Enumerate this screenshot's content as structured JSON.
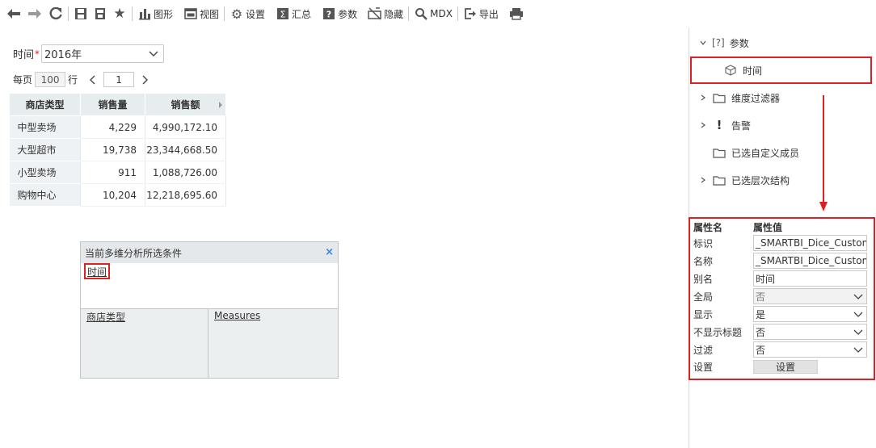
{
  "toolbar": {
    "chart_label": "图形",
    "view_label": "视图",
    "settings_label": "设置",
    "summary_label": "汇总",
    "params_label": "参数",
    "hide_label": "隐藏",
    "mdx_label": "MDX",
    "export_label": "导出"
  },
  "filter": {
    "label": "时间",
    "required_mark": "*",
    "value": "2016年"
  },
  "pager": {
    "per_page_label": "每页",
    "per_page_value": "100",
    "row_label": "行",
    "current_page": "1"
  },
  "table": {
    "headers": [
      "商店类型",
      "销售量",
      "销售额"
    ],
    "rows": [
      {
        "type": "中型卖场",
        "qty": "4,229",
        "amount": "4,990,172.10"
      },
      {
        "type": "大型超市",
        "qty": "19,738",
        "amount": "23,344,668.50"
      },
      {
        "type": "小型卖场",
        "qty": "911",
        "amount": "1,088,726.00"
      },
      {
        "type": "购物中心",
        "qty": "10,204",
        "amount": "12,218,695.60"
      }
    ]
  },
  "conditions": {
    "title": "当前多维分析所选条件",
    "close": "×",
    "selected_chip": "时间",
    "col1": "商店类型",
    "col2": "Measures"
  },
  "tree": {
    "params": {
      "bracket": "[?]",
      "label": "参数"
    },
    "param_time": "时间",
    "dim_filter": "维度过滤器",
    "alert": "告警",
    "custom_members": "已选自定义成员",
    "hierarchy": "已选层次结构"
  },
  "props": {
    "head_name": "属性名",
    "head_value": "属性值",
    "id_label": "标识",
    "id_value": "_SMARTBI_Dice_Custom",
    "name_label": "名称",
    "name_value": "_SMARTBI_Dice_Custom",
    "alias_label": "别名",
    "alias_value": "时间",
    "global_label": "全局",
    "global_value": "否",
    "show_label": "显示",
    "show_value": "是",
    "hide_title_label": "不显示标题",
    "hide_title_value": "否",
    "filter_label": "过滤",
    "filter_value": "否",
    "setting_label": "设置",
    "setting_button": "设置"
  },
  "colors": {
    "highlight": "#e02020",
    "header_bg": "#e7ecef"
  }
}
